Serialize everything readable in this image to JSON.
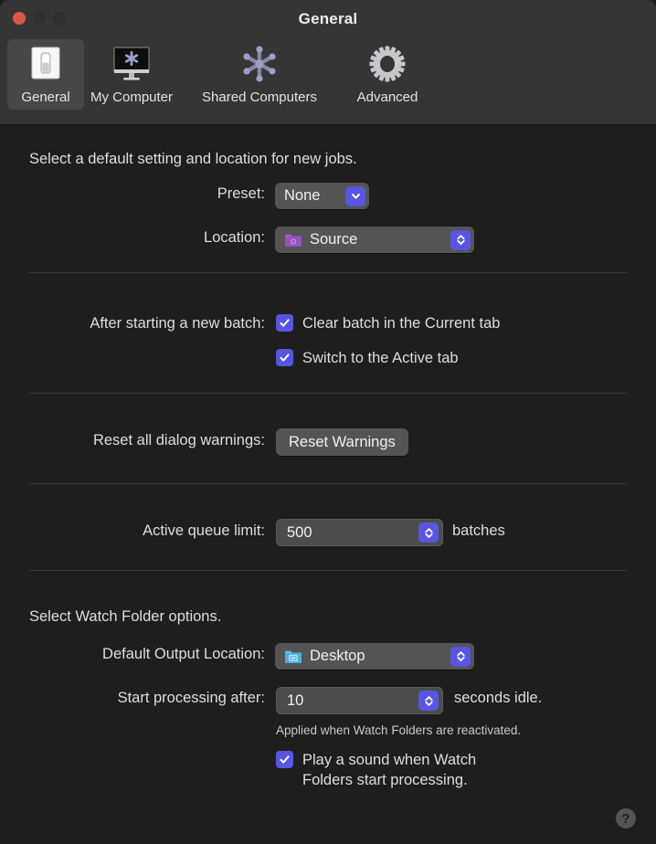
{
  "window": {
    "title": "General",
    "traffic_lights": [
      {
        "name": "close-button",
        "color": "#d9584c"
      },
      {
        "name": "minimize-button",
        "color": "#2f2f2f"
      },
      {
        "name": "zoom-button",
        "color": "#2f2f2f"
      }
    ]
  },
  "toolbar": {
    "tabs": [
      {
        "label": "General",
        "icon": "light-switch-icon",
        "selected": true
      },
      {
        "label": "My Computer",
        "icon": "display-monitor-icon",
        "selected": false
      },
      {
        "label": "Shared Computers",
        "icon": "network-nodes-icon",
        "selected": false
      },
      {
        "label": "Advanced",
        "icon": "gear-icon",
        "selected": false
      }
    ]
  },
  "sections": {
    "defaults": {
      "heading": "Select a default setting and location for new jobs.",
      "preset_label": "Preset:",
      "preset_value": "None",
      "location_label": "Location:",
      "location_value": "Source",
      "location_icon": "purple-folder-icon"
    },
    "batch": {
      "label": "After starting a new batch:",
      "checkbox_clear": "Clear batch in the Current tab",
      "checkbox_switch": "Switch to the Active tab"
    },
    "warnings": {
      "label": "Reset all dialog warnings:",
      "button": "Reset Warnings"
    },
    "queue": {
      "label": "Active queue limit:",
      "value": "500",
      "suffix": "batches"
    },
    "watch": {
      "heading": "Select Watch Folder options.",
      "output_label": "Default Output Location:",
      "output_value": "Desktop",
      "output_icon": "blue-folder-icon",
      "delay_label": "Start processing after:",
      "delay_value": "10",
      "delay_suffix": "seconds idle.",
      "note": "Applied when Watch Folders are reactivated.",
      "sound_checkbox": "Play a sound when Watch\nFolders start processing."
    }
  },
  "help": {
    "glyph": "?"
  },
  "colors": {
    "accent": "#5856e0",
    "window_bg": "#1e1e1e",
    "toolbar_bg": "#353535",
    "control_bg": "#545454",
    "purple_folder": "#9a52c8",
    "blue_folder": "#4db2e8"
  }
}
